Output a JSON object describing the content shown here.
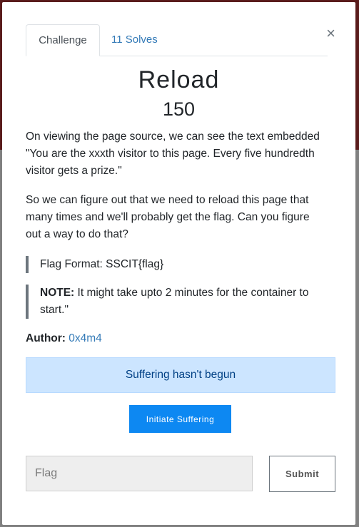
{
  "tabs": {
    "challenge_label": "Challenge",
    "solves_label": "11 Solves"
  },
  "close_icon": "×",
  "challenge": {
    "name": "Reload",
    "value": "150",
    "description_p1": "On viewing the page source, we can see the text embedded \"You are the xxxth visitor to this page. Every five hundredth visitor gets a prize.\"",
    "description_p2": "So we can figure out that we need to reload this page that many times and we'll probably get the flag. Can you figure out a way to do that?",
    "flag_format": "Flag Format: SSCIT{flag}",
    "note_label": "NOTE:",
    "note_text": " It might take upto 2 minutes for the container to start.\"",
    "author_label": "Author:",
    "author_name": "0x4m4"
  },
  "status": {
    "message": "Suffering hasn't begun"
  },
  "actions": {
    "initiate_label": "Initiate Suffering"
  },
  "flag_form": {
    "placeholder": "Flag",
    "value": "",
    "submit_label": "Submit"
  },
  "colors": {
    "link": "#337ab7",
    "primary_button": "#0d88f2",
    "info_bg": "#cce5ff",
    "info_text": "#004085"
  }
}
